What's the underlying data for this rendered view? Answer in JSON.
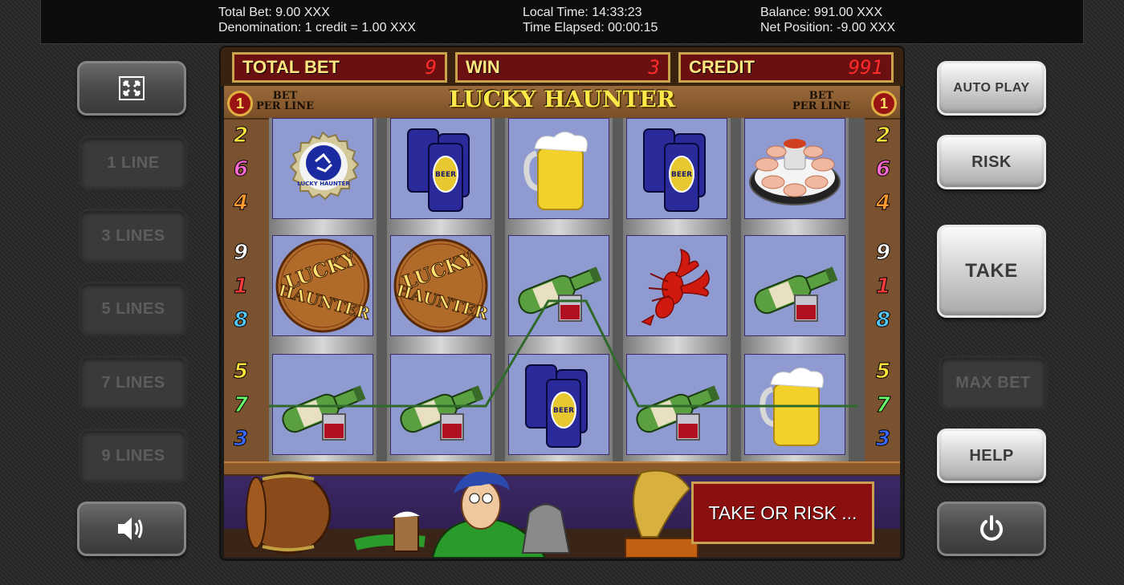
{
  "info": {
    "total_bet": "Total Bet: 9.00 XXX",
    "denomination": "Denomination: 1 credit = 1.00 XXX",
    "local_time": "Local Time: 14:33:23",
    "time_elapsed": "Time Elapsed: 00:00:15",
    "balance": "Balance: 991.00 XXX",
    "net_position": "Net Position: -9.00 XXX"
  },
  "left_buttons": {
    "fullscreen_icon": "fullscreen-icon",
    "line1": "1 LINE",
    "line3": "3 LINES",
    "line5": "5 LINES",
    "line7": "7 LINES",
    "line9": "9 LINES",
    "sound_icon": "speaker-icon"
  },
  "right_buttons": {
    "auto_play": "AUTO PLAY",
    "risk": "RISK",
    "take": "TAKE",
    "max_bet": "MAX BET",
    "help": "HELP",
    "power_icon": "power-icon"
  },
  "game": {
    "title": "LUCKY HAUNTER",
    "total_bet_label": "TOTAL BET",
    "total_bet_value": "9",
    "win_label": "WIN",
    "win_value": "3",
    "credit_label": "CREDIT",
    "credit_value": "991",
    "bet_per_line_label_1": "BET",
    "bet_per_line_label_2": "PER LINE",
    "bet_per_line_left": "1",
    "bet_per_line_right": "1",
    "message": "TAKE OR RISK ...",
    "left_line_numbers": [
      "2",
      "6",
      "4",
      "9",
      "1",
      "8",
      "5",
      "7",
      "3"
    ],
    "right_line_numbers": [
      "2",
      "6",
      "4",
      "9",
      "1",
      "8",
      "5",
      "7",
      "3"
    ],
    "line_number_colors": [
      "#ffe23a",
      "#ff6ad5",
      "#ff9b2a",
      "#ffffff",
      "#ff3a3a",
      "#55c8ff",
      "#ffe23a",
      "#6aff6a",
      "#3a6aff"
    ],
    "reels": [
      [
        "bottle-cap",
        "lucky-haunter-logo",
        "wine-bottle"
      ],
      [
        "beer-cans",
        "lucky-haunter-logo",
        "wine-bottle"
      ],
      [
        "beer-mug",
        "wine-bottle",
        "beer-cans"
      ],
      [
        "beer-cans",
        "lobster",
        "wine-bottle"
      ],
      [
        "shrimp-plate",
        "wine-bottle",
        "beer-mug"
      ]
    ],
    "symbol_texts": {
      "logo_line1": "LUCKY",
      "logo_line2": "HAUNTER",
      "beer_can": "BEER",
      "cap_text": "LUCKY HAUNTER"
    }
  }
}
